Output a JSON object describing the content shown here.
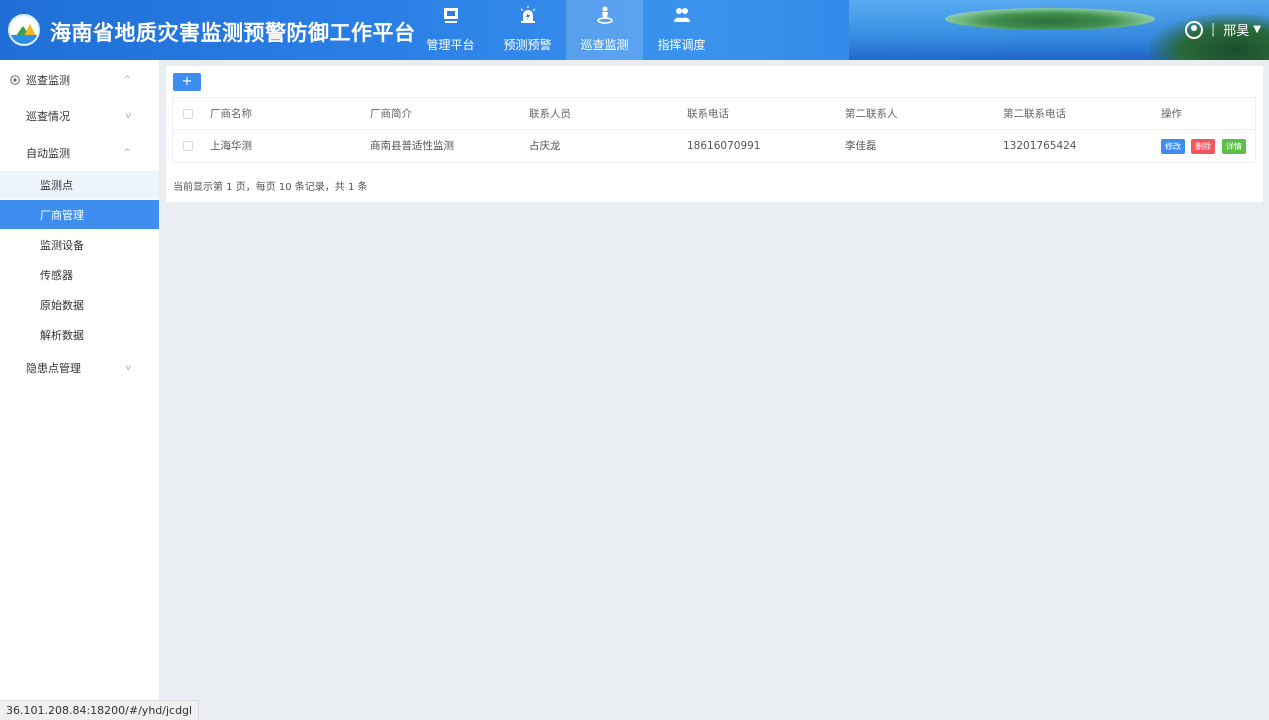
{
  "app": {
    "title": "海南省地质灾害监测预警防御工作平台"
  },
  "nav": [
    {
      "label": "管理平台",
      "icon": "monitor-icon"
    },
    {
      "label": "预测预警",
      "icon": "alarm-light-icon"
    },
    {
      "label": "巡查监测",
      "icon": "patrol-person-icon"
    },
    {
      "label": "指挥调度",
      "icon": "group-icon"
    }
  ],
  "user": {
    "name": "邢昊",
    "separator": "|",
    "caret": "▼"
  },
  "sidebar": {
    "items": [
      {
        "label": "巡查监测",
        "icon": "compass-icon",
        "chevron": "^"
      },
      {
        "label": "巡查情况",
        "chevron": "v"
      },
      {
        "label": "自动监测",
        "chevron": "^"
      },
      {
        "label": "监测点"
      },
      {
        "label": "厂商管理"
      },
      {
        "label": "监测设备"
      },
      {
        "label": "传感器"
      },
      {
        "label": "原始数据"
      },
      {
        "label": "解析数据"
      },
      {
        "label": "隐患点管理",
        "chevron": "v"
      }
    ]
  },
  "toolbar": {
    "add_label": "+"
  },
  "table": {
    "headers": [
      "厂商名称",
      "厂商简介",
      "联系人员",
      "联系电话",
      "第二联系人",
      "第二联系电话",
      "操作"
    ],
    "rows": [
      {
        "name": "上海华测",
        "intro": "商南县普适性监测",
        "contact": "占庆龙",
        "phone": "18616070991",
        "contact2": "李佳磊",
        "phone2": "13201765424"
      }
    ],
    "actions": {
      "edit": "修改",
      "delete": "删除",
      "detail": "详情"
    }
  },
  "pagination_info": "当前显示第 1 页，每页 10 条记录，共 1 条",
  "statusbar": {
    "url": "36.101.208.84:18200/#/yhd/jcdgl"
  },
  "colors": {
    "primary": "#3d8ef0",
    "danger": "#f0575c",
    "success": "#5bbf4a",
    "header": "#2a7fe6"
  }
}
